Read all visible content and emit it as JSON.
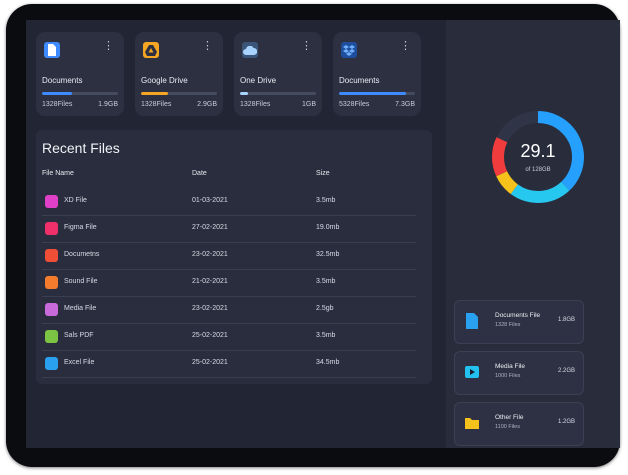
{
  "storage_cards": [
    {
      "title": "Documents",
      "files": "1328Files",
      "size": "1.9GB",
      "icon": "document-icon",
      "color": "#3d8bff",
      "used_fraction": 0.4
    },
    {
      "title": "Google Drive",
      "files": "1328Files",
      "size": "2.9GB",
      "icon": "google-drive-icon",
      "color": "#f5a623",
      "used_fraction": 0.35
    },
    {
      "title": "One Drive",
      "files": "1328Files",
      "size": "1GB",
      "icon": "cloud-icon",
      "color": "#a9d3ff",
      "used_fraction": 0.1
    },
    {
      "title": "Documents",
      "files": "5328Files",
      "size": "7.3GB",
      "icon": "dropbox-icon",
      "color": "#3d8bff",
      "used_fraction": 0.88
    }
  ],
  "recent_files": {
    "title": "Recent Files",
    "columns": [
      "File Name",
      "Date",
      "Size"
    ],
    "rows": [
      {
        "name": "XD File",
        "date": "01-03-2021",
        "size": "3.5mb",
        "color": "#e040c8",
        "icon": "xd-file-icon"
      },
      {
        "name": "Figma File",
        "date": "27-02-2021",
        "size": "19.0mb",
        "color": "#f0306a",
        "icon": "figma-file-icon"
      },
      {
        "name": "Documetns",
        "date": "23-02-2021",
        "size": "32.5mb",
        "color": "#f04e37",
        "icon": "document-file-icon"
      },
      {
        "name": "Sound File",
        "date": "21-02-2021",
        "size": "3.5mb",
        "color": "#f47c2c",
        "icon": "sound-file-icon"
      },
      {
        "name": "Media File",
        "date": "23-02-2021",
        "size": "2.5gb",
        "color": "#c96adb",
        "icon": "media-file-icon"
      },
      {
        "name": "Sals PDF",
        "date": "25-02-2021",
        "size": "3.5mb",
        "color": "#7cc544",
        "icon": "pdf-file-icon"
      },
      {
        "name": "Excel File",
        "date": "25-02-2021",
        "size": "34.5mb",
        "color": "#2aa0f0",
        "icon": "excel-file-icon"
      }
    ]
  },
  "storage_summary": {
    "value": "29.1",
    "caption": "of 128GB",
    "segments": [
      {
        "color": "#26a0ff",
        "fraction": 0.38
      },
      {
        "color": "#27c8f0",
        "fraction": 0.22
      },
      {
        "color": "#f5c21b",
        "fraction": 0.08
      },
      {
        "color": "#f03c3c",
        "fraction": 0.14
      },
      {
        "color": "#2f3447",
        "fraction": 0.18
      }
    ]
  },
  "file_type_cards": [
    {
      "title": "Documents File",
      "files": "1328 Files",
      "size": "1.8GB",
      "icon": "document-icon",
      "color": "#2aa0f0"
    },
    {
      "title": "Media File",
      "files": "1000 Files",
      "size": "2.2GB",
      "icon": "play-icon",
      "color": "#22c1f0"
    },
    {
      "title": "Other File",
      "files": "1100 Files",
      "size": "1.2GB",
      "icon": "folder-icon",
      "color": "#f5c21b"
    }
  ]
}
